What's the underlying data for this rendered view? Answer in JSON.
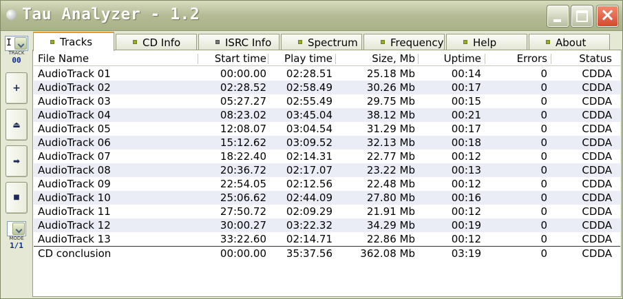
{
  "window": {
    "title": "Tau Analyzer - 1.2",
    "controls": {
      "minimize": "minimize",
      "maximize": "maximize",
      "close": "×"
    }
  },
  "leftbar": {
    "track_selector": {
      "selected": "I",
      "caption": "TRACK",
      "value": "00"
    },
    "buttons": [
      {
        "name": "add",
        "glyph": "+"
      },
      {
        "name": "eject",
        "glyph": "⏏"
      },
      {
        "name": "play",
        "glyph": "➡"
      },
      {
        "name": "stop",
        "glyph": "■"
      }
    ],
    "mode_selector": {
      "caption": "MODE",
      "value": "1/1"
    }
  },
  "tabs": [
    {
      "label": "Tracks",
      "active": true,
      "indicator": "green"
    },
    {
      "label": "CD Info",
      "active": false,
      "indicator": "green"
    },
    {
      "label": "ISRC Info",
      "active": false,
      "indicator": "gray"
    },
    {
      "label": "Spectrum",
      "active": false,
      "indicator": "green"
    },
    {
      "label": "Frequency",
      "active": false,
      "indicator": "green"
    },
    {
      "label": "Help",
      "active": false,
      "indicator": "green"
    },
    {
      "label": "About",
      "active": false,
      "indicator": "green"
    }
  ],
  "table": {
    "columns": [
      "File Name",
      "Start time",
      "Play time",
      "Size, Mb",
      "Uptime",
      "Errors",
      "Status"
    ],
    "rows": [
      [
        "AudioTrack 01",
        "00:00.00",
        "02:28.51",
        "25.18 Mb",
        "00:14",
        "0",
        "CDDA"
      ],
      [
        "AudioTrack 02",
        "02:28.52",
        "02:58.49",
        "30.26 Mb",
        "00:17",
        "0",
        "CDDA"
      ],
      [
        "AudioTrack 03",
        "05:27.27",
        "02:55.49",
        "29.75 Mb",
        "00:15",
        "0",
        "CDDA"
      ],
      [
        "AudioTrack 04",
        "08:23.02",
        "03:45.04",
        "38.12 Mb",
        "00:21",
        "0",
        "CDDA"
      ],
      [
        "AudioTrack 05",
        "12:08.07",
        "03:04.54",
        "31.29 Mb",
        "00:17",
        "0",
        "CDDA"
      ],
      [
        "AudioTrack 06",
        "15:12.62",
        "03:09.52",
        "32.13 Mb",
        "00:18",
        "0",
        "CDDA"
      ],
      [
        "AudioTrack 07",
        "18:22.40",
        "02:14.31",
        "22.77 Mb",
        "00:12",
        "0",
        "CDDA"
      ],
      [
        "AudioTrack 08",
        "20:36.72",
        "02:17.07",
        "23.22 Mb",
        "00:13",
        "0",
        "CDDA"
      ],
      [
        "AudioTrack 09",
        "22:54.05",
        "02:12.56",
        "22.48 Mb",
        "00:12",
        "0",
        "CDDA"
      ],
      [
        "AudioTrack 10",
        "25:06.62",
        "02:44.09",
        "27.80 Mb",
        "00:16",
        "0",
        "CDDA"
      ],
      [
        "AudioTrack 11",
        "27:50.72",
        "02:09.29",
        "21.91 Mb",
        "00:12",
        "0",
        "CDDA"
      ],
      [
        "AudioTrack 12",
        "30:00.27",
        "03:22.32",
        "34.29 Mb",
        "00:19",
        "0",
        "CDDA"
      ],
      [
        "AudioTrack 13",
        "33:22.60",
        "02:14.71",
        "22.86 Mb",
        "00:12",
        "0",
        "CDDA"
      ]
    ],
    "total": [
      "CD conclusion",
      "00:00.00",
      "35:37.56",
      "362.08 Mb",
      "03:19",
      "0",
      "CDDA"
    ]
  }
}
